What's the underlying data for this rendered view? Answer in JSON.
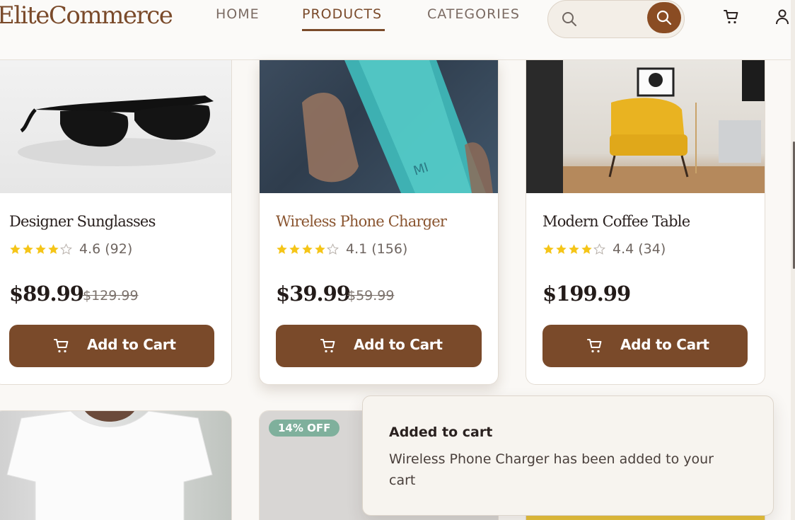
{
  "header": {
    "logo": "EliteCommerce",
    "nav": [
      {
        "label": "HOME",
        "active": false
      },
      {
        "label": "PRODUCTS",
        "active": true
      },
      {
        "label": "CATEGORIES",
        "active": false
      }
    ],
    "search": {
      "placeholder": ""
    }
  },
  "products": [
    {
      "name": "Designer Sunglasses",
      "rating": 4.6,
      "rating_text": "4.6 (92)",
      "price": "$89.99",
      "old_price": "$129.99",
      "button": "Add to Cart",
      "stars_filled": 4
    },
    {
      "name": "Wireless Phone Charger",
      "rating": 4.1,
      "rating_text": "4.1 (156)",
      "price": "$39.99",
      "old_price": "$59.99",
      "button": "Add to Cart",
      "stars_filled": 4
    },
    {
      "name": "Modern Coffee Table",
      "rating": 4.4,
      "rating_text": "4.4 (34)",
      "price": "$199.99",
      "old_price": "",
      "button": "Add to Cart",
      "stars_filled": 4
    }
  ],
  "row2": {
    "badge": "14% OFF"
  },
  "toast": {
    "title": "Added to cart",
    "message": "Wireless Phone Charger has been added to your cart"
  },
  "colors": {
    "brand": "#7a4a2a",
    "star": "#f5c518",
    "badge": "#7fb09c"
  },
  "icons": [
    "search-icon",
    "cart-icon",
    "user-icon",
    "star-icon"
  ]
}
